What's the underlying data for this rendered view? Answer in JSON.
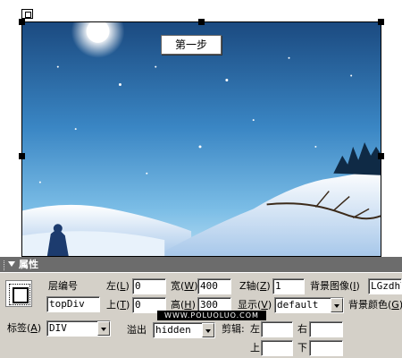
{
  "design": {
    "step_text": "第一步"
  },
  "panel": {
    "title": "属性",
    "layer_id_label": "层编号",
    "layer_id_value": "topDiv",
    "left_label": "左",
    "left_key": "L",
    "left_value": "0",
    "top_label": "上",
    "top_key": "T",
    "top_value": "0",
    "width_label": "宽",
    "width_key": "W",
    "width_value": "400",
    "height_label": "高",
    "height_key": "H",
    "height_value": "300",
    "z_label": "Z轴",
    "z_key": "Z",
    "z_value": "1",
    "visibility_label": "显示",
    "visibility_key": "V",
    "visibility_value": "default",
    "bg_image_label": "背景图像",
    "bg_image_key": "I",
    "bg_image_value": "LGzdhY",
    "bg_color_label": "背景颜色",
    "bg_color_key": "G",
    "tag_label": "标签",
    "tag_key": "A",
    "tag_value": "DIV",
    "overflow_label": "溢出",
    "overflow_value": "hidden",
    "clip_label": "剪辑:",
    "clip_left_label": "左",
    "clip_right_label": "右",
    "clip_top_label": "上",
    "clip_bottom_label": "下",
    "watermark": "WWW.POLUOLUO.COM"
  },
  "colors": {
    "panel_bg": "#d4d0c8",
    "title_bar": "#6c6c6c",
    "sky_top": "#1d4f86",
    "sky_bottom": "#5fa8d9"
  }
}
